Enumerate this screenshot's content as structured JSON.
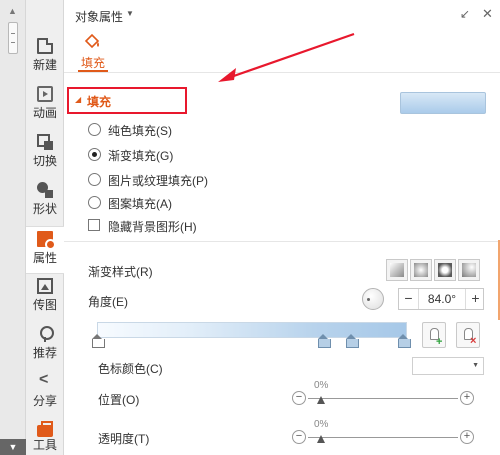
{
  "panel": {
    "title": "对象属性",
    "tab": "填充"
  },
  "toolbar": {
    "items": [
      {
        "label": "新建",
        "icon": "new-doc-icon"
      },
      {
        "label": "动画",
        "icon": "animation-icon"
      },
      {
        "label": "切换",
        "icon": "transition-icon"
      },
      {
        "label": "形状",
        "icon": "shape-icon"
      },
      {
        "label": "属性",
        "icon": "properties-icon",
        "active": true
      },
      {
        "label": "传图",
        "icon": "upload-image-icon"
      },
      {
        "label": "推荐",
        "icon": "recommend-icon"
      },
      {
        "label": "分享",
        "icon": "share-icon"
      },
      {
        "label": "工具",
        "icon": "toolbox-icon"
      }
    ]
  },
  "fill": {
    "section_title": "填充",
    "options": [
      {
        "label": "纯色填充(S)",
        "checked": false
      },
      {
        "label": "渐变填充(G)",
        "checked": true
      },
      {
        "label": "图片或纹理填充(P)",
        "checked": false
      },
      {
        "label": "图案填充(A)",
        "checked": false
      }
    ],
    "hide_background": {
      "label": "隐藏背景图形(H)",
      "checked": false
    }
  },
  "gradient": {
    "style_label": "渐变样式(R)",
    "angle_label": "角度(E)",
    "angle_value": "84.0°",
    "stop_color_label": "色标颜色(C)",
    "position_label": "位置(O)",
    "position_value": "0%",
    "transparency_label": "透明度(T)",
    "transparency_value": "0%"
  },
  "colors": {
    "accent": "#e05a1a",
    "annotation_red": "#e8182d",
    "gradient_light": "#f7fbff",
    "gradient_dark": "#a6c8e8"
  }
}
